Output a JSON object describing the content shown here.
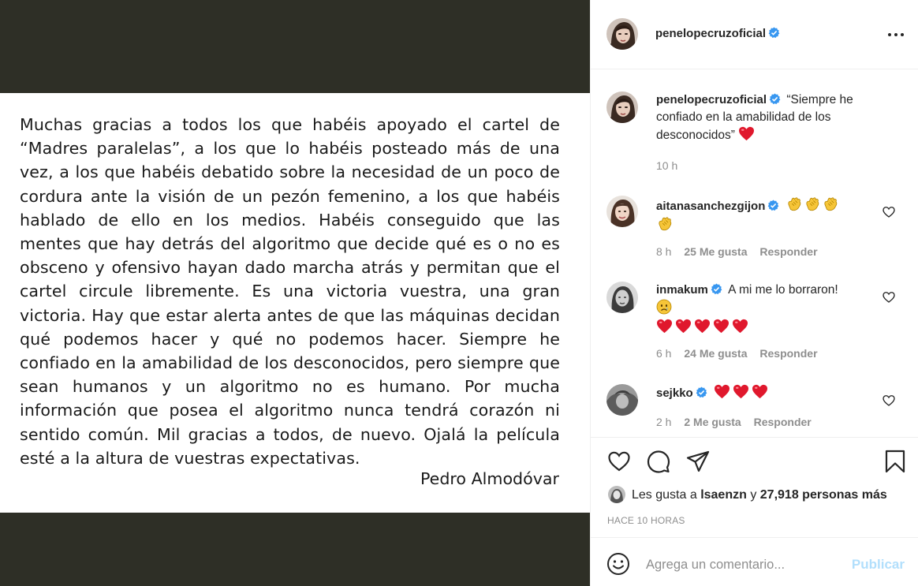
{
  "post": {
    "letter_text": "Muchas gracias a todos los que habéis apoyado el cartel de “Madres paralelas”, a los que lo habéis posteado más de una vez, a los que habéis debatido sobre la necesidad de un poco de cordura ante la visión de un pezón femenino, a los que habéis hablado de ello en los medios. Habéis conseguido que las mentes que hay detrás del algoritmo que decide qué es o no es obsceno y ofensivo hayan dado marcha atrás y permitan que el cartel circule libremente. Es una victoria vuestra, una gran victoria. Hay que estar alerta antes de que las máquinas decidan qué podemos hacer y qué no podemos hacer. Siempre he confiado en la amabilidad de los desconocidos, pero siempre que sean humanos y un algoritmo no es humano. Por mucha información que posea el algoritmo nunca tendrá corazón ni sentido común. Mil gracias a todos, de nuevo. Ojalá la película esté a la altura de vuestras expectativas.",
    "signature": "Pedro Almodóvar"
  },
  "header": {
    "username": "penelopecruzoficial",
    "more_icon": "ellipsis-icon"
  },
  "caption": {
    "username": "penelopecruzoficial",
    "text": "“Siempre he confiado en la amabilidad de los desconocidos”",
    "emoji": "heart",
    "time": "10 h"
  },
  "comments": [
    {
      "username": "aitanasanchezgijon",
      "verified": true,
      "emoji": "clapping-hands x4",
      "time": "8 h",
      "likes": "25 Me gusta",
      "reply": "Responder"
    },
    {
      "username": "inmakum",
      "verified": true,
      "text": "A mi me lo borraron!",
      "emoji": "sad-face, heart x5",
      "time": "6 h",
      "likes": "24 Me gusta",
      "reply": "Responder"
    },
    {
      "username": "sejkko",
      "verified": true,
      "emoji": "heart x3",
      "time": "2 h",
      "likes": "2 Me gusta",
      "reply": "Responder"
    }
  ],
  "actions": {
    "like_icon": "heart-outline-icon",
    "comment_icon": "comment-bubble-icon",
    "share_icon": "paper-plane-icon",
    "save_icon": "bookmark-icon"
  },
  "likes": {
    "prefix": "Les gusta a",
    "user": "lsaenzn",
    "conjunction": "y",
    "count": "27,918 personas más"
  },
  "timestamp": "HACE 10 HORAS",
  "add_comment": {
    "placeholder": "Agrega un comentario...",
    "post_label": "Publicar"
  },
  "colors": {
    "image_band_dark": "#2e2f26",
    "verified_blue": "#3897f0",
    "heart_red": "#e0182d",
    "post_button_disabled": "#b2dffc",
    "meta_gray": "#8e8e8e"
  }
}
